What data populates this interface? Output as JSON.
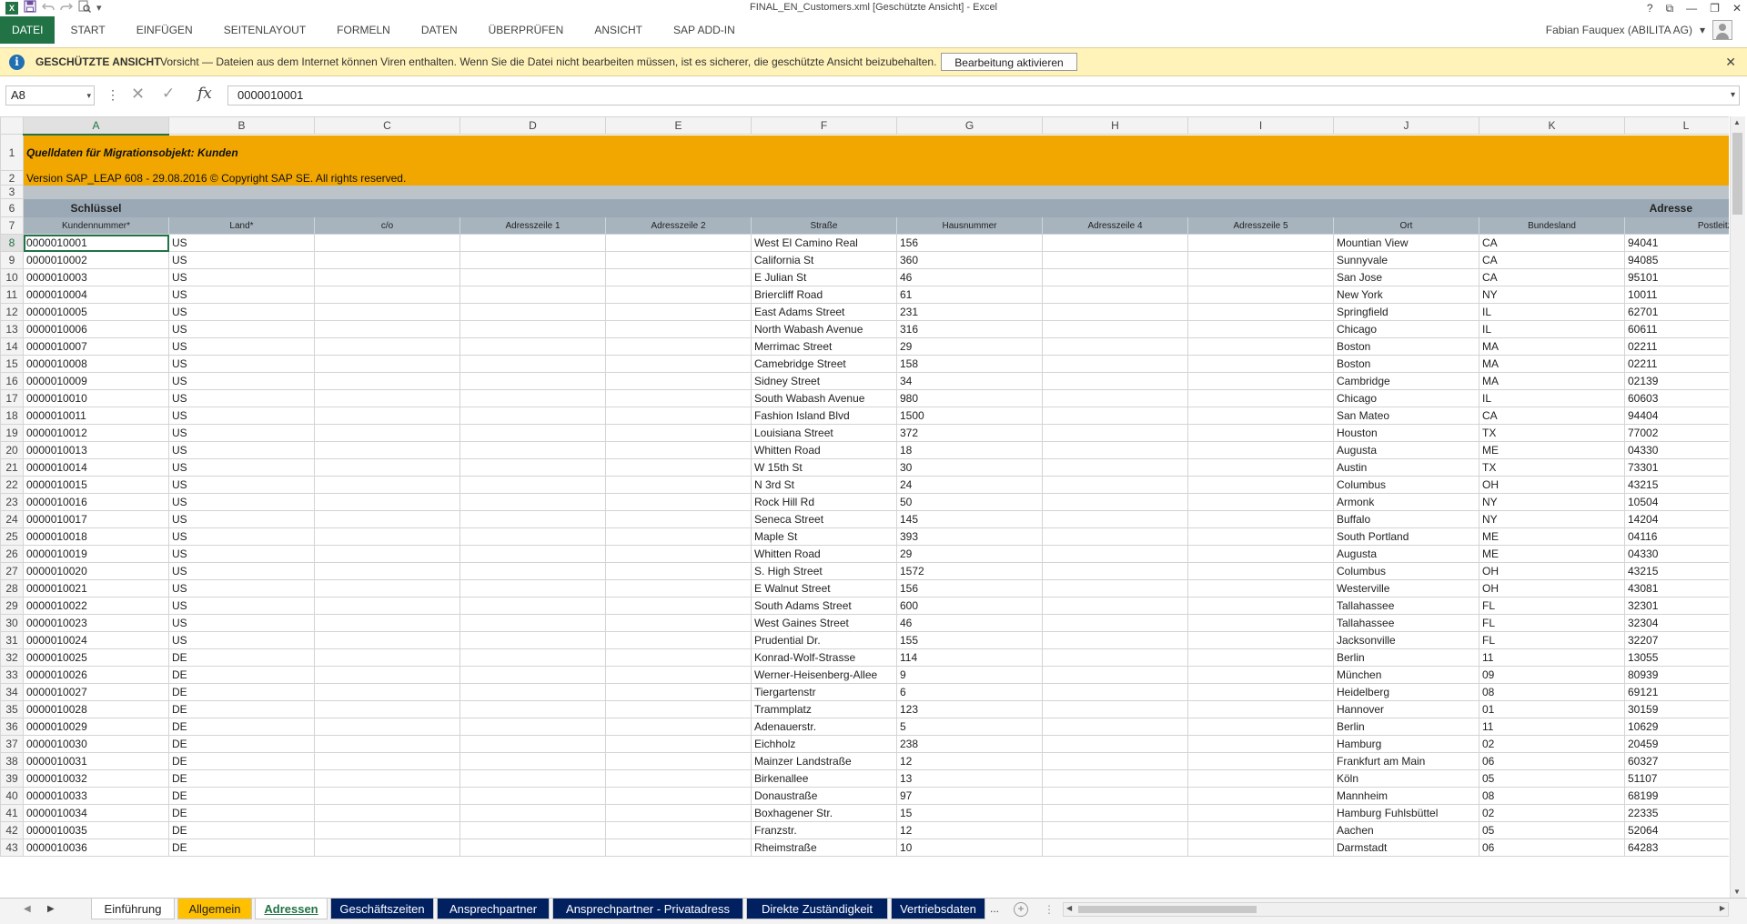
{
  "window": {
    "title": "FINAL_EN_Customers.xml  [Geschützte Ansicht] - Excel",
    "controls": [
      "?",
      "⧉",
      "—",
      "❐",
      "✕"
    ]
  },
  "qat": {
    "logo": "X",
    "save_icon": "save-icon",
    "undo_icon": "undo-icon",
    "redo_icon": "redo-icon",
    "preview_icon": "print-preview-icon",
    "customize": "▾"
  },
  "ribbon": {
    "tabs": [
      "DATEI",
      "START",
      "EINFÜGEN",
      "SEITENLAYOUT",
      "FORMELN",
      "DATEN",
      "ÜBERPRÜFEN",
      "ANSICHT",
      "SAP ADD-IN"
    ]
  },
  "user": {
    "name": "Fabian Fauquex (ABILITA AG)",
    "caret": "▾"
  },
  "protected_view": {
    "icon": "i",
    "title": "GESCHÜTZTE ANSICHT",
    "message": "Vorsicht — Dateien aus dem Internet können Viren enthalten. Wenn Sie die Datei nicht bearbeiten müssen, ist es sicherer, die geschützte Ansicht beizubehalten.",
    "button": "Bearbeitung aktivieren",
    "close": "✕"
  },
  "formula_bar": {
    "name_box": "A8",
    "name_box_arrow": "▾",
    "dots": "⋮",
    "cancel": "✕",
    "enter": "✓",
    "fx": "fx",
    "value": "0000010001",
    "expand": "▾"
  },
  "sheet": {
    "columns": [
      "A",
      "B",
      "C",
      "D",
      "E",
      "F",
      "G",
      "H",
      "I",
      "J",
      "K",
      "L"
    ],
    "title": "Quelldaten für Migrationsobjekt:  Kunden",
    "version": "Version SAP_LEAP 608  - 29.08.2016 © Copyright SAP SE. All rights reserved.",
    "group_key": "Schlüssel",
    "group_address": "Adresse",
    "field_headers": [
      "Kundennummer*",
      "Land*",
      "c/o",
      "Adresszeile 1",
      "Adresszeile 2",
      "Straße",
      "Hausnummer",
      "Adresszeile 4",
      "Adresszeile 5",
      "Ort",
      "Bundesland",
      "Postleitzahl"
    ],
    "header_row_numbers": [
      "1",
      "2",
      "3",
      "6",
      "7"
    ],
    "rows": [
      {
        "n": "8",
        "id": "0000010001",
        "land": "US",
        "street": "West El Camino Real",
        "house": "156",
        "city": "Mountian View",
        "state": "CA",
        "zip": "94041"
      },
      {
        "n": "9",
        "id": "0000010002",
        "land": "US",
        "street": "California St",
        "house": "360",
        "city": "Sunnyvale",
        "state": "CA",
        "zip": "94085"
      },
      {
        "n": "10",
        "id": "0000010003",
        "land": "US",
        "street": "E Julian St",
        "house": "46",
        "city": "San Jose",
        "state": "CA",
        "zip": "95101"
      },
      {
        "n": "11",
        "id": "0000010004",
        "land": "US",
        "street": "Briercliff Road",
        "house": "61",
        "city": "New York",
        "state": "NY",
        "zip": "10011"
      },
      {
        "n": "12",
        "id": "0000010005",
        "land": "US",
        "street": "East Adams Street",
        "house": "231",
        "city": "Springfield",
        "state": "IL",
        "zip": "62701"
      },
      {
        "n": "13",
        "id": "0000010006",
        "land": "US",
        "street": "North Wabash Avenue",
        "house": "316",
        "city": "Chicago",
        "state": "IL",
        "zip": "60611"
      },
      {
        "n": "14",
        "id": "0000010007",
        "land": "US",
        "street": "Merrimac Street",
        "house": "29",
        "city": "Boston",
        "state": "MA",
        "zip": "02211"
      },
      {
        "n": "15",
        "id": "0000010008",
        "land": "US",
        "street": "Camebridge Street",
        "house": "158",
        "city": "Boston",
        "state": "MA",
        "zip": "02211"
      },
      {
        "n": "16",
        "id": "0000010009",
        "land": "US",
        "street": "Sidney Street",
        "house": "34",
        "city": "Cambridge",
        "state": "MA",
        "zip": "02139"
      },
      {
        "n": "17",
        "id": "0000010010",
        "land": "US",
        "street": "South Wabash Avenue",
        "house": "980",
        "city": "Chicago",
        "state": "IL",
        "zip": "60603"
      },
      {
        "n": "18",
        "id": "0000010011",
        "land": "US",
        "street": "Fashion Island Blvd",
        "house": "1500",
        "city": "San Mateo",
        "state": "CA",
        "zip": "94404"
      },
      {
        "n": "19",
        "id": "0000010012",
        "land": "US",
        "street": "Louisiana Street",
        "house": "372",
        "city": "Houston",
        "state": "TX",
        "zip": "77002"
      },
      {
        "n": "20",
        "id": "0000010013",
        "land": "US",
        "street": "Whitten Road",
        "house": "18",
        "city": "Augusta",
        "state": "ME",
        "zip": "04330"
      },
      {
        "n": "21",
        "id": "0000010014",
        "land": "US",
        "street": "W 15th St",
        "house": "30",
        "city": "Austin",
        "state": "TX",
        "zip": "73301"
      },
      {
        "n": "22",
        "id": "0000010015",
        "land": "US",
        "street": "N 3rd St",
        "house": "24",
        "city": "Columbus",
        "state": "OH",
        "zip": "43215"
      },
      {
        "n": "23",
        "id": "0000010016",
        "land": "US",
        "street": "Rock Hill Rd",
        "house": "50",
        "city": "Armonk",
        "state": "NY",
        "zip": "10504"
      },
      {
        "n": "24",
        "id": "0000010017",
        "land": "US",
        "street": "Seneca Street",
        "house": "145",
        "city": "Buffalo",
        "state": "NY",
        "zip": "14204"
      },
      {
        "n": "25",
        "id": "0000010018",
        "land": "US",
        "street": "Maple St",
        "house": "393",
        "city": "South Portland",
        "state": "ME",
        "zip": "04116"
      },
      {
        "n": "26",
        "id": "0000010019",
        "land": "US",
        "street": "Whitten Road",
        "house": "29",
        "city": "Augusta",
        "state": "ME",
        "zip": "04330"
      },
      {
        "n": "27",
        "id": "0000010020",
        "land": "US",
        "street": "S. High Street",
        "house": "1572",
        "city": "Columbus",
        "state": "OH",
        "zip": "43215"
      },
      {
        "n": "28",
        "id": "0000010021",
        "land": "US",
        "street": "E Walnut Street",
        "house": "156",
        "city": "Westerville",
        "state": "OH",
        "zip": "43081"
      },
      {
        "n": "29",
        "id": "0000010022",
        "land": "US",
        "street": "South Adams Street",
        "house": "600",
        "city": "Tallahassee",
        "state": "FL",
        "zip": "32301"
      },
      {
        "n": "30",
        "id": "0000010023",
        "land": "US",
        "street": "West Gaines Street",
        "house": "46",
        "city": "Tallahassee",
        "state": "FL",
        "zip": "32304"
      },
      {
        "n": "31",
        "id": "0000010024",
        "land": "US",
        "street": "Prudential Dr.",
        "house": "155",
        "city": "Jacksonville",
        "state": "FL",
        "zip": "32207"
      },
      {
        "n": "32",
        "id": "0000010025",
        "land": "DE",
        "street": "Konrad-Wolf-Strasse",
        "house": "114",
        "city": "Berlin",
        "state": "11",
        "zip": "13055"
      },
      {
        "n": "33",
        "id": "0000010026",
        "land": "DE",
        "street": "Werner-Heisenberg-Allee",
        "house": "9",
        "city": "München",
        "state": "09",
        "zip": "80939"
      },
      {
        "n": "34",
        "id": "0000010027",
        "land": "DE",
        "street": "Tiergartenstr",
        "house": "6",
        "city": "Heidelberg",
        "state": "08",
        "zip": "69121"
      },
      {
        "n": "35",
        "id": "0000010028",
        "land": "DE",
        "street": "Trammplatz",
        "house": "123",
        "city": "Hannover",
        "state": "01",
        "zip": "30159"
      },
      {
        "n": "36",
        "id": "0000010029",
        "land": "DE",
        "street": "Adenauerstr.",
        "house": "5",
        "city": "Berlin",
        "state": "11",
        "zip": "10629"
      },
      {
        "n": "37",
        "id": "0000010030",
        "land": "DE",
        "street": "Eichholz",
        "house": "238",
        "city": "Hamburg",
        "state": "02",
        "zip": "20459"
      },
      {
        "n": "38",
        "id": "0000010031",
        "land": "DE",
        "street": "Mainzer Landstraße",
        "house": "12",
        "city": "Frankfurt am Main",
        "state": "06",
        "zip": "60327"
      },
      {
        "n": "39",
        "id": "0000010032",
        "land": "DE",
        "street": "Birkenallee",
        "house": "13",
        "city": "Köln",
        "state": "05",
        "zip": "51107"
      },
      {
        "n": "40",
        "id": "0000010033",
        "land": "DE",
        "street": "Donaustraße",
        "house": "97",
        "city": "Mannheim",
        "state": "08",
        "zip": "68199"
      },
      {
        "n": "41",
        "id": "0000010034",
        "land": "DE",
        "street": "Boxhagener Str.",
        "house": "15",
        "city": "Hamburg Fuhlsbüttel",
        "state": "02",
        "zip": "22335"
      },
      {
        "n": "42",
        "id": "0000010035",
        "land": "DE",
        "street": "Franzstr.",
        "house": "12",
        "city": "Aachen",
        "state": "05",
        "zip": "52064"
      },
      {
        "n": "43",
        "id": "0000010036",
        "land": "DE",
        "street": "Rheimstraße",
        "house": "10",
        "city": "Darmstadt",
        "state": "06",
        "zip": "64283"
      }
    ]
  },
  "sheet_tabs": {
    "nav_prev": "◀",
    "nav_next": "▶",
    "tabs": [
      {
        "label": "Einführung",
        "style": "plain"
      },
      {
        "label": "Allgemein",
        "style": "yellow"
      },
      {
        "label": "Adressen",
        "style": "active"
      },
      {
        "label": "Geschäftszeiten",
        "style": "blue"
      },
      {
        "label": "Ansprechpartner",
        "style": "blue"
      },
      {
        "label": "Ansprechpartner - Privatadress",
        "style": "blue"
      },
      {
        "label": "Direkte Zuständigkeit",
        "style": "blue"
      },
      {
        "label": "Vertriebsdaten",
        "style": "blue"
      }
    ],
    "more": "...",
    "add": "+",
    "separator": "⋮"
  },
  "colors": {
    "accent": "#217346",
    "title_band": "#f1a700",
    "group_header": "#9aa9b5",
    "field_header": "#a7b4be",
    "message_bar": "#fff3b9",
    "tab_blue": "#002060",
    "tab_yellow": "#ffc000"
  }
}
